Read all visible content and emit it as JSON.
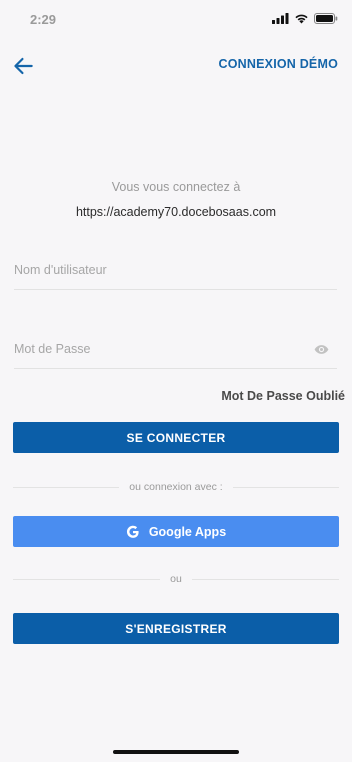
{
  "status_bar": {
    "time": "2:29",
    "icons": [
      "signal-icon",
      "wifi-icon",
      "battery-icon"
    ]
  },
  "nav": {
    "back_icon": "arrow-left-icon",
    "demo_link": "CONNEXION DÉMO"
  },
  "platform": {
    "connecting_label": "Vous vous connectez à",
    "url": "https://academy70.docebosaas.com"
  },
  "form": {
    "username": {
      "value": "",
      "placeholder": "Nom d'utilisateur"
    },
    "password": {
      "value": "",
      "placeholder": "Mot de Passe"
    },
    "forgot_password": "Mot De Passe Oublié",
    "login_button": "SE CONNECTER",
    "social_divider": "ou connexion avec :",
    "google_button": "Google Apps",
    "or_divider": "ou",
    "register_button": "S'ENREGISTRER"
  },
  "colors": {
    "primary": "#0b5ea8",
    "google_blue": "#4a8df0",
    "link_blue": "#1565a9",
    "background": "#f7f6f8"
  }
}
